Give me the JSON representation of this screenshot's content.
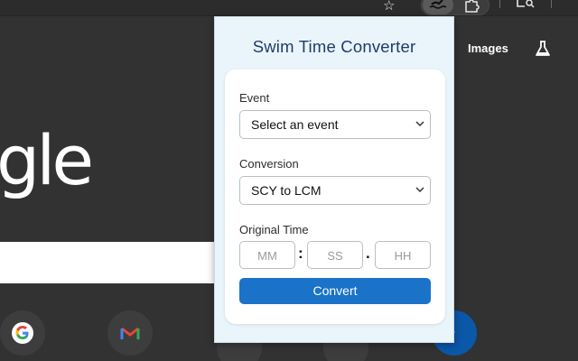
{
  "browser": {
    "toolbar_icons": [
      "star-icon",
      "swimmer-extension-icon",
      "puzzle-icon",
      "lens-icon"
    ]
  },
  "new_tab": {
    "logo_fragment": "gle",
    "images_link": "Images",
    "shortcuts": [
      "google-shortcut",
      "gmail-shortcut"
    ]
  },
  "popup": {
    "title": "Swim Time Converter",
    "event": {
      "label": "Event",
      "selected": "Select an event"
    },
    "conversion": {
      "label": "Conversion",
      "selected": "SCY to LCM"
    },
    "original_time": {
      "label": "Original Time",
      "minutes_placeholder": "MM",
      "seconds_placeholder": "SS",
      "hundredths_placeholder": "HH",
      "sep1": ":",
      "sep2": "."
    },
    "convert_label": "Convert"
  },
  "colors": {
    "popup_bg": "#eaf4fb",
    "title": "#1e3d6b",
    "button": "#1a73c9"
  }
}
